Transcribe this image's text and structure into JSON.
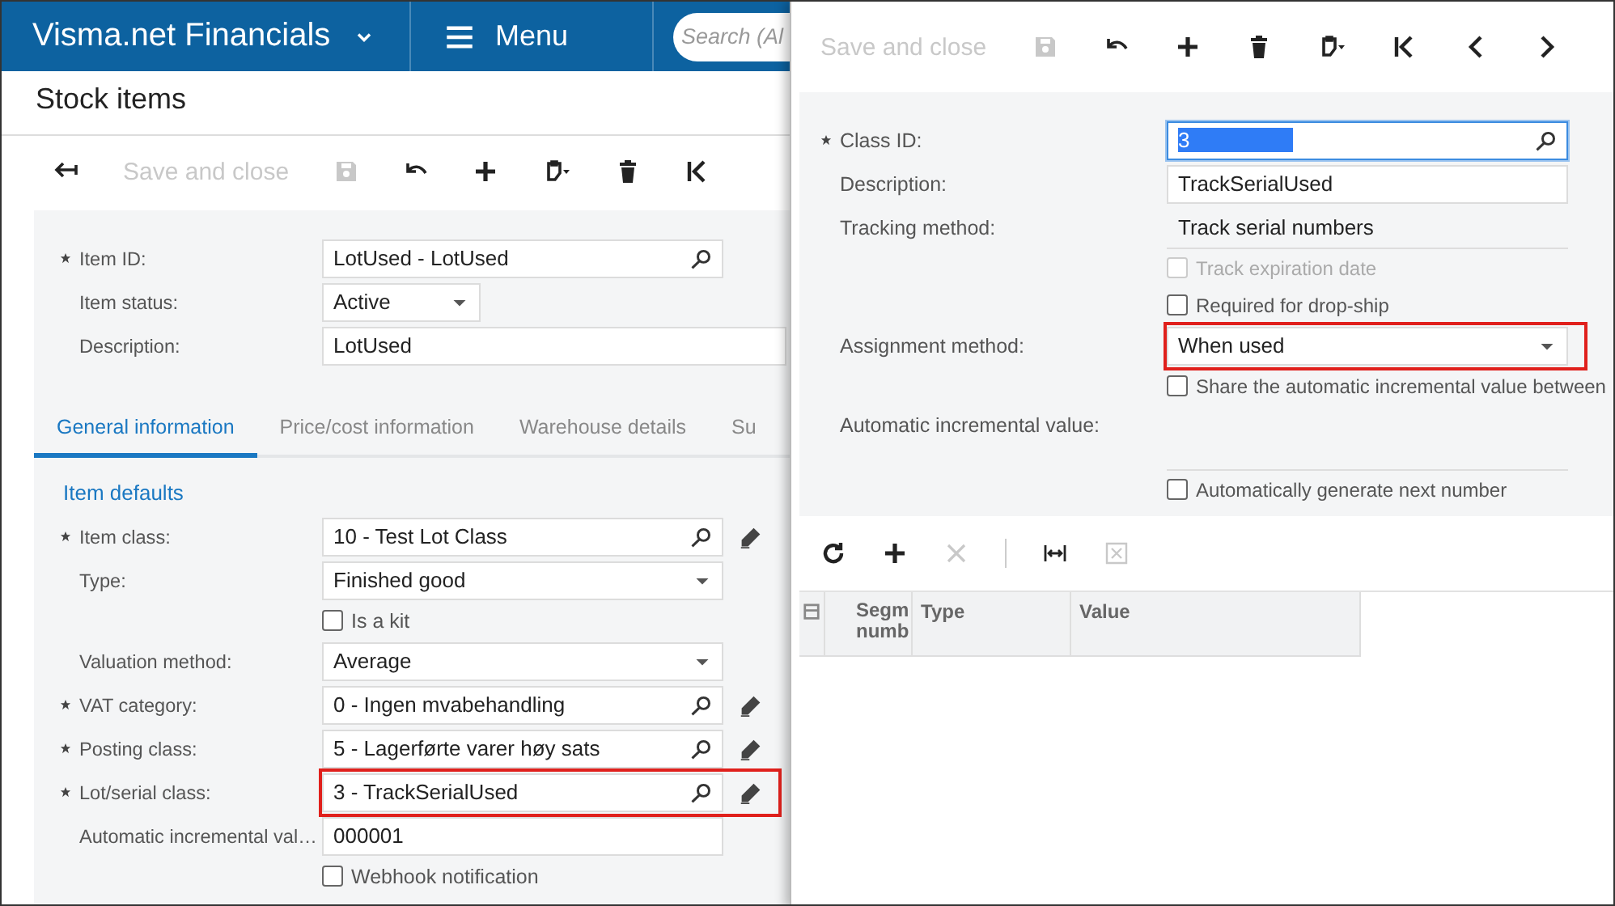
{
  "header": {
    "brand": "Visma.net Financials",
    "menu": "Menu",
    "search": {
      "placeholder": "Search (Al"
    }
  },
  "page": {
    "title": "Stock items"
  },
  "toolbar": [
    {
      "kind": "back",
      "disabled": false
    },
    {
      "kind": "text",
      "label": "Save and close",
      "disabled": true
    },
    {
      "kind": "save",
      "disabled": true
    },
    {
      "kind": "undo",
      "disabled": false
    },
    {
      "kind": "add",
      "disabled": false
    },
    {
      "kind": "clipboard",
      "disabled": false
    },
    {
      "kind": "delete",
      "disabled": false
    },
    {
      "kind": "first",
      "disabled": false
    }
  ],
  "summary": [
    {
      "label": "Item ID:",
      "required": true,
      "kind": "lookup",
      "value": "LotUsed - LotUsed",
      "edit": false,
      "highlighted": false
    },
    {
      "label": "Item status:",
      "required": false,
      "kind": "picker",
      "value": "Active"
    },
    {
      "label": "Description:",
      "required": false,
      "kind": "wide",
      "value": "LotUsed"
    }
  ],
  "tabs": [
    {
      "label": "General information",
      "selected": true
    },
    {
      "label": "Price/cost information",
      "selected": false
    },
    {
      "label": "Warehouse details",
      "selected": false
    },
    {
      "label": "Su",
      "selected": false
    }
  ],
  "section": {
    "title": "Item defaults"
  },
  "fields": [
    {
      "label": "Item class:",
      "required": true,
      "kind": "lookup",
      "value": "10 - Test Lot Class",
      "edit": true,
      "highlighted": false
    },
    {
      "label": "Type:",
      "required": false,
      "kind": "select",
      "value": "Finished good",
      "highlighted": false
    },
    {
      "label": "Is a kit",
      "kind": "checkbox",
      "checked": false,
      "disabled": false
    },
    {
      "label": "Valuation method:",
      "required": false,
      "kind": "select",
      "value": "Average",
      "highlighted": false
    },
    {
      "label": "VAT category:",
      "required": true,
      "kind": "lookup",
      "value": "0 - Ingen mvabehandling",
      "edit": true,
      "highlighted": false
    },
    {
      "label": "Posting class:",
      "required": true,
      "kind": "lookup",
      "value": "5 - Lagerførte varer høy sats",
      "edit": true,
      "highlighted": false
    },
    {
      "label": "Lot/serial class:",
      "required": true,
      "kind": "lookup",
      "value": "3 - TrackSerialUsed",
      "edit": true,
      "highlighted": true
    },
    {
      "label": "Automatic incremental val…",
      "required": false,
      "kind": "text",
      "value": "000001"
    },
    {
      "label": "Webhook notification",
      "kind": "checkbox",
      "checked": false,
      "disabled": false
    }
  ],
  "class_panel": {
    "toolbar": [
      {
        "kind": "text",
        "label": "Save and close",
        "disabled": true
      },
      {
        "kind": "save",
        "disabled": true
      },
      {
        "kind": "undo",
        "disabled": false
      },
      {
        "kind": "add",
        "disabled": false
      },
      {
        "kind": "delete",
        "disabled": false
      },
      {
        "kind": "clipboard",
        "disabled": false
      },
      {
        "kind": "first",
        "disabled": false
      },
      {
        "kind": "prev",
        "disabled": false
      },
      {
        "kind": "next",
        "disabled": false
      }
    ],
    "fields": [
      {
        "label": "Class ID:",
        "required": true,
        "kind": "lookup",
        "value": "3",
        "focused": true,
        "edit": false,
        "highlighted": false
      },
      {
        "label": "Description:",
        "required": false,
        "kind": "text",
        "value": "TrackSerialUsed"
      },
      {
        "label": "Tracking method:",
        "required": false,
        "kind": "display",
        "value": "Track serial numbers"
      },
      {
        "label": "Track expiration date",
        "kind": "checkbox",
        "checked": false,
        "disabled": true
      },
      {
        "label": "Required for drop-ship",
        "kind": "checkbox",
        "checked": false,
        "disabled": false
      },
      {
        "label": "Assignment method:",
        "required": false,
        "kind": "select",
        "value": "When used",
        "highlighted": true
      },
      {
        "label": "Share the automatic incremental value between",
        "kind": "checkbox",
        "checked": false,
        "disabled": false
      },
      {
        "label": "Automatic incremental value:",
        "required": false,
        "kind": "blank"
      },
      {
        "label": "Automatically generate next number",
        "kind": "checkbox",
        "checked": false,
        "disabled": false
      }
    ],
    "grid": {
      "toolbar": [
        {
          "kind": "refresh",
          "disabled": false
        },
        {
          "kind": "add",
          "disabled": false
        },
        {
          "kind": "remove",
          "disabled": true
        },
        {
          "kind": "separator"
        },
        {
          "kind": "fit",
          "disabled": false
        },
        {
          "kind": "excel",
          "disabled": true
        }
      ],
      "columns": [
        "Segm numb",
        "Type",
        "Value"
      ]
    }
  }
}
